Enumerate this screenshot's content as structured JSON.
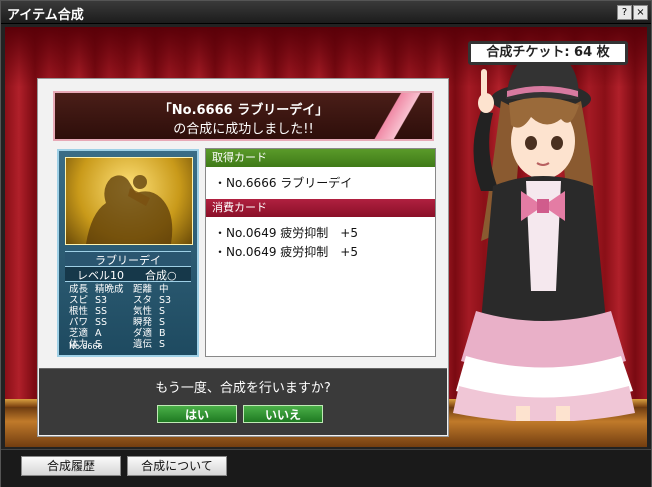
{
  "window": {
    "title": "アイテム合成",
    "help_label": "?",
    "close_label": "×"
  },
  "ticket": {
    "text": "合成チケット: 64 枚"
  },
  "result": {
    "line1": "「No.6666 ラブリーデイ」",
    "line2": "の合成に成功しました!!"
  },
  "card": {
    "name": "ラブリーデイ",
    "level": "レベル10",
    "synth": "合成○",
    "stats": [
      [
        "成長",
        "精晩成",
        "距離",
        "中"
      ],
      [
        "スピ",
        "S3",
        "スタ",
        "S3"
      ],
      [
        "根性",
        "SS",
        "気性",
        "S"
      ],
      [
        "パワ",
        "SS",
        "瞬発",
        "S"
      ],
      [
        "芝適",
        "A",
        "ダ適",
        "B"
      ],
      [
        "体力",
        "S",
        "遺伝",
        "S"
      ]
    ],
    "number": "No.6666"
  },
  "acquired": {
    "header": "取得カード",
    "items": [
      "・No.6666 ラブリーデイ"
    ]
  },
  "consumed": {
    "header": "消費カード",
    "items": [
      "・No.0649 疲労抑制　+5",
      "・No.0649 疲労抑制　+5"
    ]
  },
  "prompt": {
    "question": "もう一度、合成を行いますか?",
    "yes_label": "はい",
    "no_label": "いいえ"
  },
  "bottom": {
    "history_label": "合成履歴",
    "about_label": "合成について"
  },
  "colors": {
    "accent_green": "#3f7a18",
    "accent_red": "#8a1028",
    "curtain": "#9a1620"
  }
}
